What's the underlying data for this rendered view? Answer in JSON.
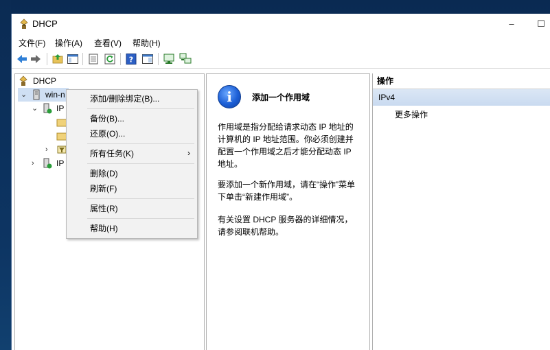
{
  "window": {
    "title": "DHCP",
    "min": "–",
    "max": "☐"
  },
  "menu": {
    "file": "文件(F)",
    "action": "操作(A)",
    "view": "查看(V)",
    "help": "帮助(H)"
  },
  "tree": {
    "root": "DHCP",
    "server": "win-n",
    "ipv4": "IP",
    "ipv6": "IP"
  },
  "description": {
    "title": "添加一个作用域",
    "para1": "作用域是指分配给请求动态 IP 地址的计算机的 IP 地址范围。你必须创建并配置一个作用域之后才能分配动态 IP 地址。",
    "para2": "要添加一个新作用域，请在“操作”菜单下单击“新建作用域”。",
    "para3": "有关设置 DHCP 服务器的详细情况，请参阅联机帮助。"
  },
  "actions": {
    "header": "操作",
    "selected": "IPv4",
    "more": "更多操作"
  },
  "context_menu": {
    "add_remove_bindings": "添加/删除绑定(B)...",
    "backup": "备份(B)...",
    "restore": "还原(O)...",
    "all_tasks": "所有任务(K)",
    "delete": "删除(D)",
    "refresh": "刷新(F)",
    "properties": "属性(R)",
    "help": "帮助(H)",
    "submenu_arrow": "›"
  },
  "colors": {
    "accent": "#1c5fd6",
    "selection": "#cfdff3",
    "menu_bg": "#f2f2f2"
  }
}
